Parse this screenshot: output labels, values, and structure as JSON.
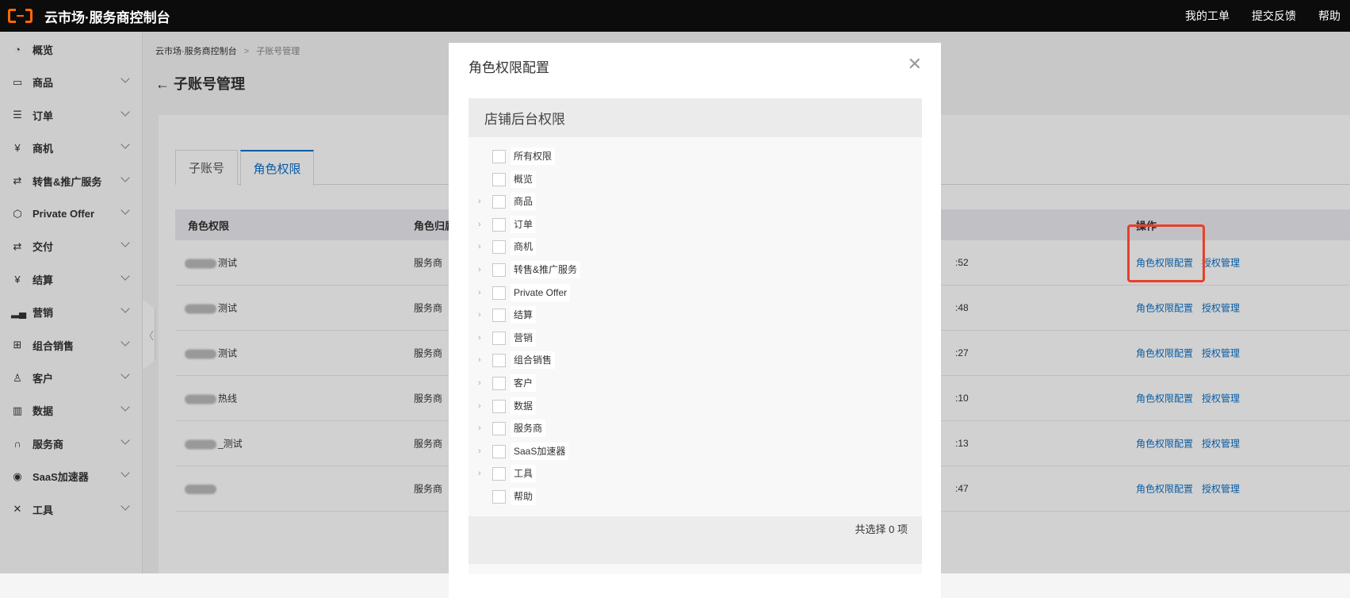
{
  "topbar": {
    "brand": "云市场·服务商控制台",
    "nav": [
      "我的工单",
      "提交反馈",
      "帮助"
    ]
  },
  "sidebar": {
    "items": [
      {
        "label": "概览",
        "icon": "pie-chart-icon",
        "glyph": "◔",
        "expandable": false
      },
      {
        "label": "商品",
        "icon": "bag-icon",
        "glyph": "▭",
        "expandable": true
      },
      {
        "label": "订单",
        "icon": "clipboard-icon",
        "glyph": "☰",
        "expandable": true
      },
      {
        "label": "商机",
        "icon": "yen-tag-icon",
        "glyph": "¥",
        "expandable": true
      },
      {
        "label": "转售&推广服务",
        "icon": "swap-icon",
        "glyph": "⇄",
        "expandable": true
      },
      {
        "label": "Private Offer",
        "icon": "cube-icon",
        "glyph": "⬡",
        "expandable": true
      },
      {
        "label": "交付",
        "icon": "delivery-doc-icon",
        "glyph": "⇄",
        "expandable": true
      },
      {
        "label": "结算",
        "icon": "yen-circle-icon",
        "glyph": "¥",
        "expandable": true
      },
      {
        "label": "营销",
        "icon": "bar-chart-icon",
        "glyph": "▂▄",
        "expandable": true
      },
      {
        "label": "组合销售",
        "icon": "grid-plus-icon",
        "glyph": "⊞",
        "expandable": true
      },
      {
        "label": "客户",
        "icon": "users-icon",
        "glyph": "♙",
        "expandable": true
      },
      {
        "label": "数据",
        "icon": "data-bars-icon",
        "glyph": "▥",
        "expandable": true
      },
      {
        "label": "服务商",
        "icon": "headset-icon",
        "glyph": "∩",
        "expandable": true
      },
      {
        "label": "SaaS加速器",
        "icon": "accelerator-icon",
        "glyph": "◉",
        "expandable": true
      },
      {
        "label": "工具",
        "icon": "tools-icon",
        "glyph": "✕",
        "expandable": true
      }
    ]
  },
  "breadcrumb": {
    "root": "云市场·服务商控制台",
    "sep": ">",
    "current": "子账号管理"
  },
  "page": {
    "title": "子账号管理",
    "back": "←"
  },
  "tabs": [
    {
      "label": "子账号",
      "active": false
    },
    {
      "label": "角色权限",
      "active": true
    }
  ],
  "table": {
    "headers": [
      "角色权限",
      "角色归属",
      "操作"
    ],
    "rows": [
      {
        "role": "测试",
        "owner": "服务商",
        "time": ":52",
        "action1": "角色权限配置",
        "action2": "授权管理"
      },
      {
        "role": "测试",
        "owner": "服务商",
        "time": ":48",
        "action1": "角色权限配置",
        "action2": "授权管理"
      },
      {
        "role": "测试",
        "owner": "服务商",
        "time": ":27",
        "action1": "角色权限配置",
        "action2": "授权管理"
      },
      {
        "role": "热线",
        "owner": "服务商",
        "time": ":10",
        "action1": "角色权限配置",
        "action2": "授权管理"
      },
      {
        "role": "_测试",
        "owner": "服务商",
        "time": ":13",
        "action1": "角色权限配置",
        "action2": "授权管理"
      },
      {
        "role": "",
        "owner": "服务商",
        "time": ":47",
        "action1": "角色权限配置",
        "action2": "授权管理"
      }
    ]
  },
  "modal": {
    "title": "角色权限配置",
    "section_title": "店铺后台权限",
    "permissions": [
      {
        "label": "所有权限",
        "expandable": false,
        "checked": false
      },
      {
        "label": "概览",
        "expandable": false,
        "checked": false
      },
      {
        "label": "商品",
        "expandable": true,
        "checked": false
      },
      {
        "label": "订单",
        "expandable": true,
        "checked": false
      },
      {
        "label": "商机",
        "expandable": true,
        "checked": false
      },
      {
        "label": "转售&推广服务",
        "expandable": true,
        "checked": false
      },
      {
        "label": "Private Offer",
        "expandable": true,
        "checked": false
      },
      {
        "label": "结算",
        "expandable": true,
        "checked": false
      },
      {
        "label": "营销",
        "expandable": true,
        "checked": false
      },
      {
        "label": "组合销售",
        "expandable": true,
        "checked": false
      },
      {
        "label": "客户",
        "expandable": true,
        "checked": false
      },
      {
        "label": "数据",
        "expandable": true,
        "checked": false
      },
      {
        "label": "服务商",
        "expandable": true,
        "checked": false
      },
      {
        "label": "SaaS加速器",
        "expandable": true,
        "checked": false
      },
      {
        "label": "工具",
        "expandable": true,
        "checked": false
      },
      {
        "label": "帮助",
        "expandable": false,
        "checked": false
      }
    ],
    "footer": "共选择 0 项"
  },
  "colors": {
    "accent": "#0b6fc6",
    "highlight": "#e8402a",
    "brand": "#ff6a00"
  }
}
